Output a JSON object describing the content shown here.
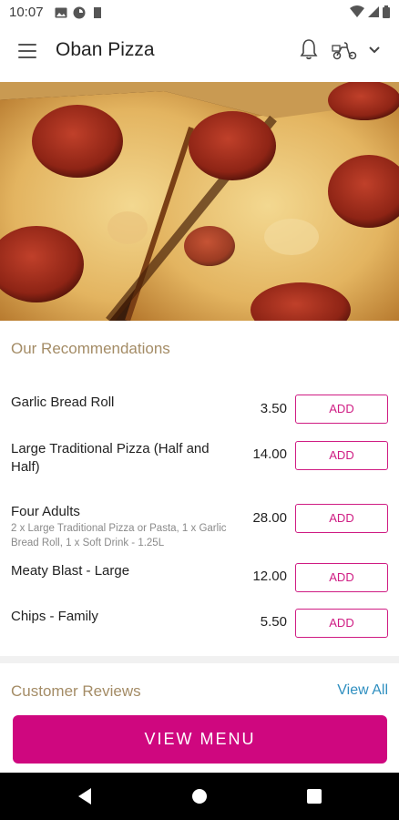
{
  "status_bar": {
    "time": "10:07",
    "left_icons": [
      "image-icon",
      "circle-app-icon",
      "sd-card-icon"
    ],
    "right_icons": [
      "wifi-icon",
      "signal-icon",
      "battery-icon"
    ]
  },
  "app_bar": {
    "title": "Oban Pizza",
    "icons": [
      "menu-icon",
      "bell-icon",
      "delivery-icon",
      "chevron-down-icon"
    ]
  },
  "hero": {
    "image": "pepperoni-pizza-photo"
  },
  "recommendations": {
    "title": "Our Recommendations",
    "add_label": "ADD",
    "items": [
      {
        "name": "Garlic Bread Roll",
        "description": "",
        "price": "3.50"
      },
      {
        "name": "Large Traditional Pizza (Half and Half)",
        "description": "",
        "price": "14.00"
      },
      {
        "name": "Four Adults",
        "description": "2 x Large Traditional Pizza or Pasta, 1 x Garlic Bread Roll, 1 x Soft Drink - 1.25L",
        "price": "28.00"
      },
      {
        "name": "Meaty Blast - Large",
        "description": "",
        "price": "12.00"
      },
      {
        "name": "Chips - Family",
        "description": "",
        "price": "5.50"
      }
    ]
  },
  "reviews": {
    "title": "Customer Reviews",
    "view_all": "View All"
  },
  "view_menu_button": "VIEW MENU",
  "colors": {
    "accent": "#cf077f",
    "section_title": "#a48c66",
    "link": "#2f8fc0"
  },
  "nav_bar": {
    "icons": [
      "back-icon",
      "home-icon",
      "recents-icon"
    ]
  }
}
